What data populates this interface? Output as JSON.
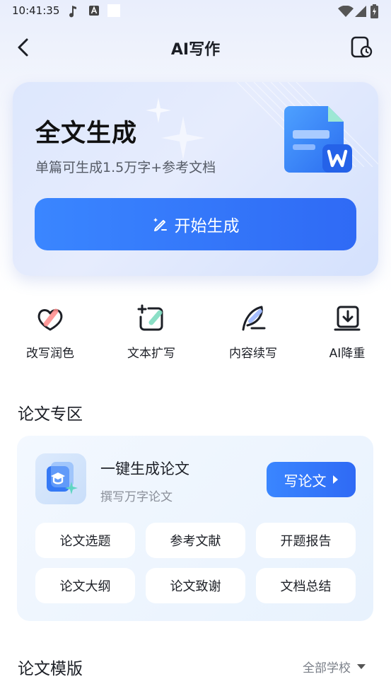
{
  "status_bar": {
    "time": "10:41:35",
    "icons": [
      "music-note-icon",
      "font-a-icon",
      "blank-square-icon",
      "wifi-icon",
      "signal-icon",
      "battery-icon"
    ]
  },
  "header": {
    "title": "AI写作",
    "back_icon": "chevron-left-icon",
    "history_icon": "document-clock-icon"
  },
  "hero": {
    "title": "全文生成",
    "subtitle": "单篇可生成1.5万字+参考文档",
    "button_label": "开始生成",
    "button_icon": "pen-sparkle-icon",
    "doc_icon": "word-document-icon",
    "colors": {
      "button": "#2f6af5",
      "doc": "#3b86ff"
    }
  },
  "tools": [
    {
      "label": "改写润色",
      "icon": "heart-rewrite-icon"
    },
    {
      "label": "文本扩写",
      "icon": "expand-square-icon"
    },
    {
      "label": "内容续写",
      "icon": "quill-feather-icon"
    },
    {
      "label": "AI降重",
      "icon": "document-download-icon"
    }
  ],
  "thesis_section": {
    "heading": "论文专区",
    "card_title": "一键生成论文",
    "card_subtitle": "撰写万字论文",
    "write_button": "写论文",
    "icon": "graduation-cap-icon",
    "chips": [
      "论文选题",
      "参考文献",
      "开题报告",
      "论文大纲",
      "论文致谢",
      "文档总结"
    ]
  },
  "templates_section": {
    "heading": "论文模版",
    "filter_label": "全部学校",
    "filter_icon": "caret-down-icon"
  }
}
